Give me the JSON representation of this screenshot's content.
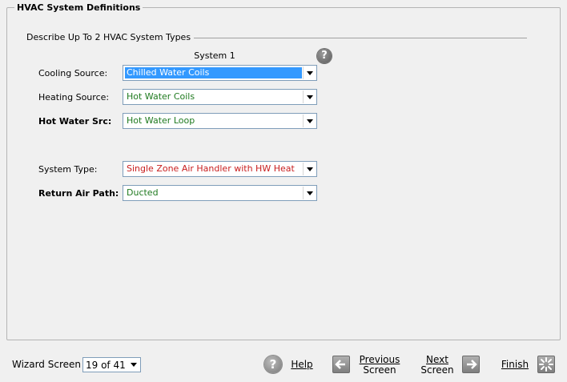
{
  "panel": {
    "title": "HVAC System Definitions",
    "subtitle": "Describe Up To 2 HVAC System Types",
    "column_header": "System 1",
    "help_glyph": "?"
  },
  "rows": [
    {
      "label": "Cooling Source:",
      "value": "Chilled Water Coils",
      "color": "#ffffff",
      "selected": true
    },
    {
      "label": "Heating Source:",
      "value": "Hot Water Coils",
      "color": "#1f7a1f"
    },
    {
      "label": "Hot Water Src:",
      "value": "Hot Water Loop",
      "color": "#1f7a1f"
    },
    {
      "label": "System Type:",
      "value": "Single Zone Air Handler with HW Heat",
      "color": "#c81e1e"
    },
    {
      "label": "Return Air Path:",
      "value": "Ducted",
      "color": "#1f7a1f"
    }
  ],
  "footer": {
    "wizard_label": "Wizard Screen",
    "wizard_value": "19 of 41",
    "help_label": "Help",
    "previous_line1": "Previous",
    "previous_line2": "Screen",
    "next_line1": "Next",
    "next_line2": "Screen",
    "finish_label": "Finish"
  }
}
